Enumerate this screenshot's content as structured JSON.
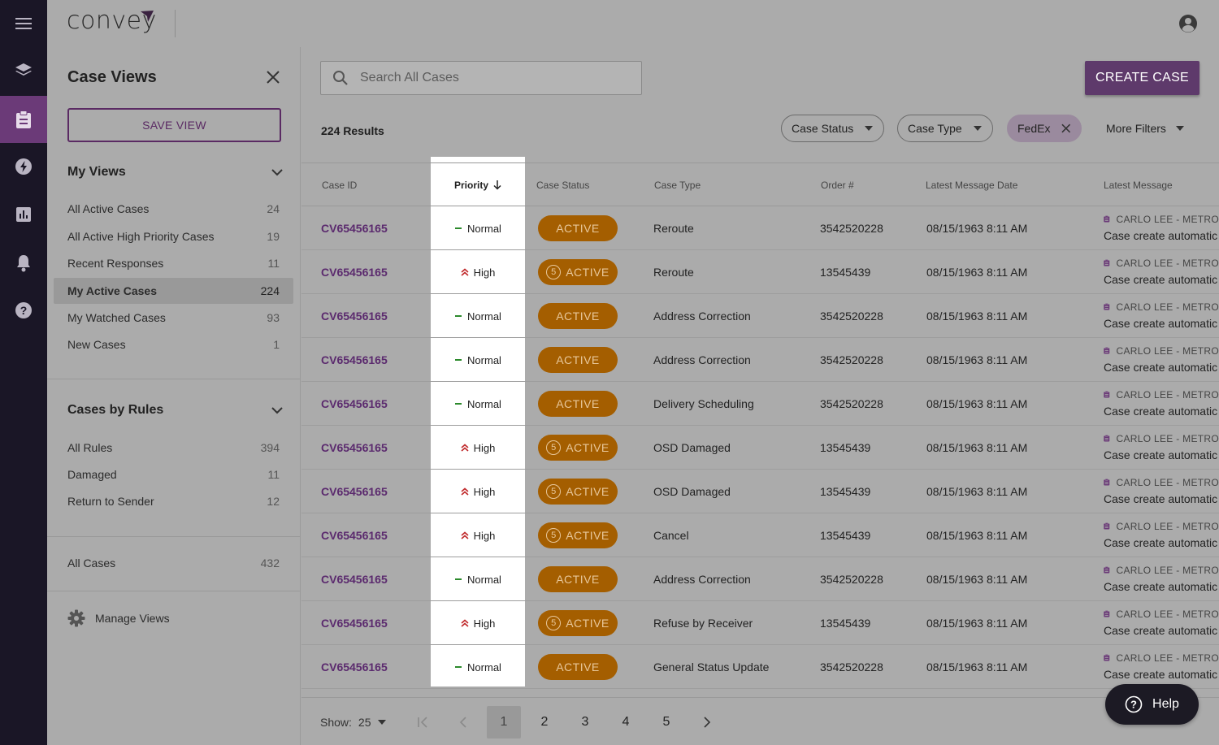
{
  "brand": {
    "logo_text": "convey"
  },
  "panel": {
    "title": "Case Views",
    "save_view": "SAVE VIEW",
    "my_views_title": "My Views",
    "my_views": [
      {
        "label": "All Active Cases",
        "count": "24"
      },
      {
        "label": "All Active High Priority  Cases",
        "count": "19"
      },
      {
        "label": "Recent Responses",
        "count": "11"
      },
      {
        "label": "My Active Cases",
        "count": "224"
      },
      {
        "label": "My Watched Cases",
        "count": "93"
      },
      {
        "label": "New Cases",
        "count": "1"
      }
    ],
    "rules_title": "Cases by Rules",
    "rules": [
      {
        "label": "All Rules",
        "count": "394"
      },
      {
        "label": "Damaged",
        "count": "11"
      },
      {
        "label": "Return to Sender",
        "count": "12"
      }
    ],
    "all_cases": {
      "label": "All Cases",
      "count": "432"
    },
    "manage_views": "Manage Views"
  },
  "toolbar": {
    "search_placeholder": "Search All Cases",
    "create_case": "CREATE CASE",
    "results": "224 Results",
    "filters": {
      "case_status": "Case Status",
      "case_type": "Case Type",
      "fedex": "FedEx",
      "more": "More Filters"
    }
  },
  "table": {
    "headers": {
      "case_id": "Case ID",
      "priority": "Priority",
      "case_status": "Case Status",
      "case_type": "Case Type",
      "order": "Order #",
      "latest_date": "Latest Message Date",
      "latest_message": "Latest Message"
    },
    "rows": [
      {
        "id": "CV65456165",
        "priority": "Normal",
        "count": "",
        "status": "ACTIVE",
        "type": "Reroute",
        "order": "3542520228",
        "date": "08/15/1963 8:11 AM",
        "msg_from": "CARLO LEE - METRO",
        "msg": "Case create automatic"
      },
      {
        "id": "CV65456165",
        "priority": "High",
        "count": "5",
        "status": "ACTIVE",
        "type": "Reroute",
        "order": "13545439",
        "date": "08/15/1963 8:11 AM",
        "msg_from": "CARLO LEE - METRO",
        "msg": "Case create automatic"
      },
      {
        "id": "CV65456165",
        "priority": "Normal",
        "count": "",
        "status": "ACTIVE",
        "type": "Address Correction",
        "order": "3542520228",
        "date": "08/15/1963 8:11 AM",
        "msg_from": "CARLO LEE - METRO",
        "msg": "Case create automatic"
      },
      {
        "id": "CV65456165",
        "priority": "Normal",
        "count": "",
        "status": "ACTIVE",
        "type": "Address Correction",
        "order": "3542520228",
        "date": "08/15/1963 8:11 AM",
        "msg_from": "CARLO LEE - METRO",
        "msg": "Case create automatic"
      },
      {
        "id": "CV65456165",
        "priority": "Normal",
        "count": "",
        "status": "ACTIVE",
        "type": "Delivery Scheduling",
        "order": "3542520228",
        "date": "08/15/1963 8:11 AM",
        "msg_from": "CARLO LEE - METRO",
        "msg": "Case create automatic"
      },
      {
        "id": "CV65456165",
        "priority": "High",
        "count": "5",
        "status": "ACTIVE",
        "type": "OSD Damaged",
        "order": "13545439",
        "date": "08/15/1963 8:11 AM",
        "msg_from": "CARLO LEE - METRO",
        "msg": "Case create automatic"
      },
      {
        "id": "CV65456165",
        "priority": "High",
        "count": "5",
        "status": "ACTIVE",
        "type": "OSD Damaged",
        "order": "13545439",
        "date": "08/15/1963 8:11 AM",
        "msg_from": "CARLO LEE - METRO",
        "msg": "Case create automatic"
      },
      {
        "id": "CV65456165",
        "priority": "High",
        "count": "5",
        "status": "ACTIVE",
        "type": "Cancel",
        "order": "13545439",
        "date": "08/15/1963 8:11 AM",
        "msg_from": "CARLO LEE - METRO",
        "msg": "Case create automatic"
      },
      {
        "id": "CV65456165",
        "priority": "Normal",
        "count": "",
        "status": "ACTIVE",
        "type": "Address Correction",
        "order": "3542520228",
        "date": "08/15/1963 8:11 AM",
        "msg_from": "CARLO LEE - METRO",
        "msg": "Case create automatic"
      },
      {
        "id": "CV65456165",
        "priority": "High",
        "count": "5",
        "status": "ACTIVE",
        "type": "Refuse by Receiver",
        "order": "13545439",
        "date": "08/15/1963 8:11 AM",
        "msg_from": "CARLO LEE - METRO",
        "msg": "Case create automatic"
      },
      {
        "id": "CV65456165",
        "priority": "Normal",
        "count": "",
        "status": "ACTIVE",
        "type": "General Status Update",
        "order": "3542520228",
        "date": "08/15/1963 8:11 AM",
        "msg_from": "CARLO LEE - METRO",
        "msg": "Case create automatic"
      }
    ]
  },
  "pagination": {
    "show_label": "Show:",
    "page_size": "25",
    "pages": [
      "1",
      "2",
      "3",
      "4",
      "5"
    ],
    "current": "1"
  },
  "help": {
    "label": "Help"
  },
  "colors": {
    "brand_purple": "#5e3a6b",
    "status_orange": "#a45e00",
    "case_link": "#5b2a6e",
    "rail": "#1a1626"
  },
  "icons": [
    "menu-icon",
    "layers-icon",
    "clipboard-icon",
    "bolt-icon",
    "chart-icon",
    "bell-icon",
    "help-circle-icon",
    "account-icon",
    "close-icon",
    "search-icon",
    "gear-icon",
    "chevron-down-icon"
  ]
}
